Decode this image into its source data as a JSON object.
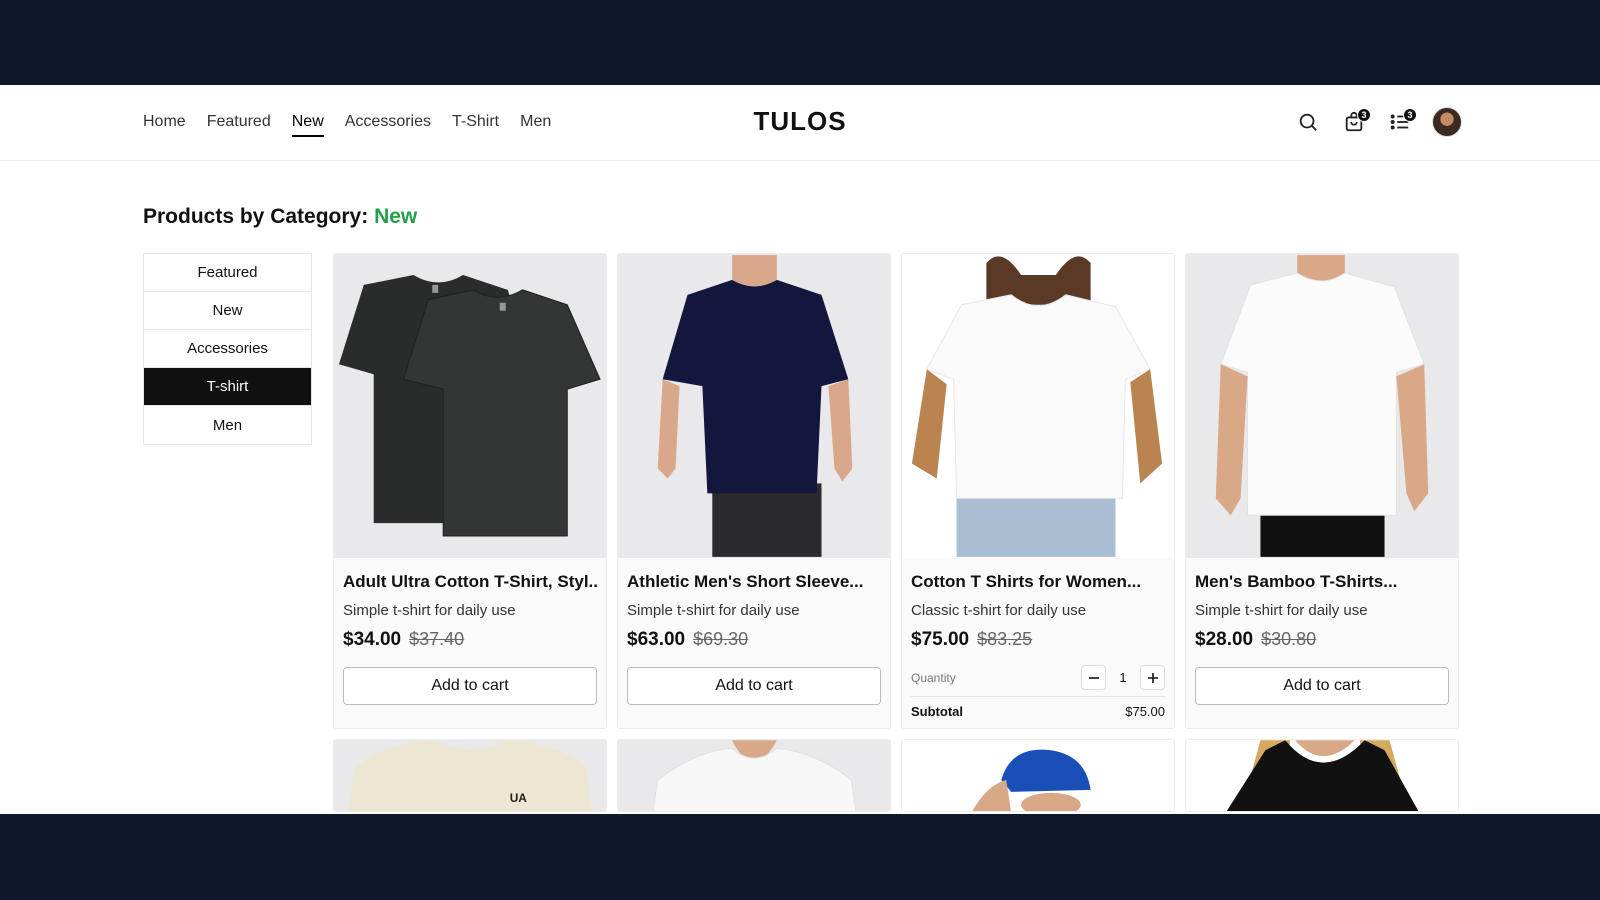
{
  "header": {
    "nav": [
      "Home",
      "Featured",
      "New",
      "Accessories",
      "T-Shirt",
      "Men"
    ],
    "active_nav": "New",
    "logo": "TULOS",
    "cart_count": "3",
    "list_count": "3"
  },
  "page": {
    "title_prefix": "Products by Category:",
    "title_category": "New"
  },
  "sidebar": {
    "items": [
      "Featured",
      "New",
      "Accessories",
      "T-shirt",
      "Men"
    ],
    "active": "T-shirt"
  },
  "products": [
    {
      "title": "Adult Ultra Cotton T-Shirt, Styl...",
      "desc": "Simple t-shirt for daily use",
      "price": "$34.00",
      "old_price": "$37.40",
      "button": "Add to cart",
      "image": "black-tshirt-pair"
    },
    {
      "title": "Athletic Men's Short Sleeve...",
      "desc": "Simple t-shirt for daily use",
      "price": "$63.00",
      "old_price": "$69.30",
      "button": "Add to cart",
      "image": "navy-athletic-tshirt"
    },
    {
      "title": "Cotton T Shirts for Women...",
      "desc": "Classic t-shirt for daily use",
      "price": "$75.00",
      "old_price": "$83.25",
      "quantity_label": "Quantity",
      "quantity": "1",
      "subtotal_label": "Subtotal",
      "subtotal": "$75.00",
      "image": "white-womens-tshirt"
    },
    {
      "title": "Men's Bamboo T-Shirts...",
      "desc": "Simple t-shirt for daily use",
      "price": "$28.00",
      "old_price": "$30.80",
      "button": "Add to cart",
      "image": "white-mens-tshirt"
    }
  ],
  "colors": {
    "category_accent": "#22a04b",
    "frame": "#0f172a"
  }
}
